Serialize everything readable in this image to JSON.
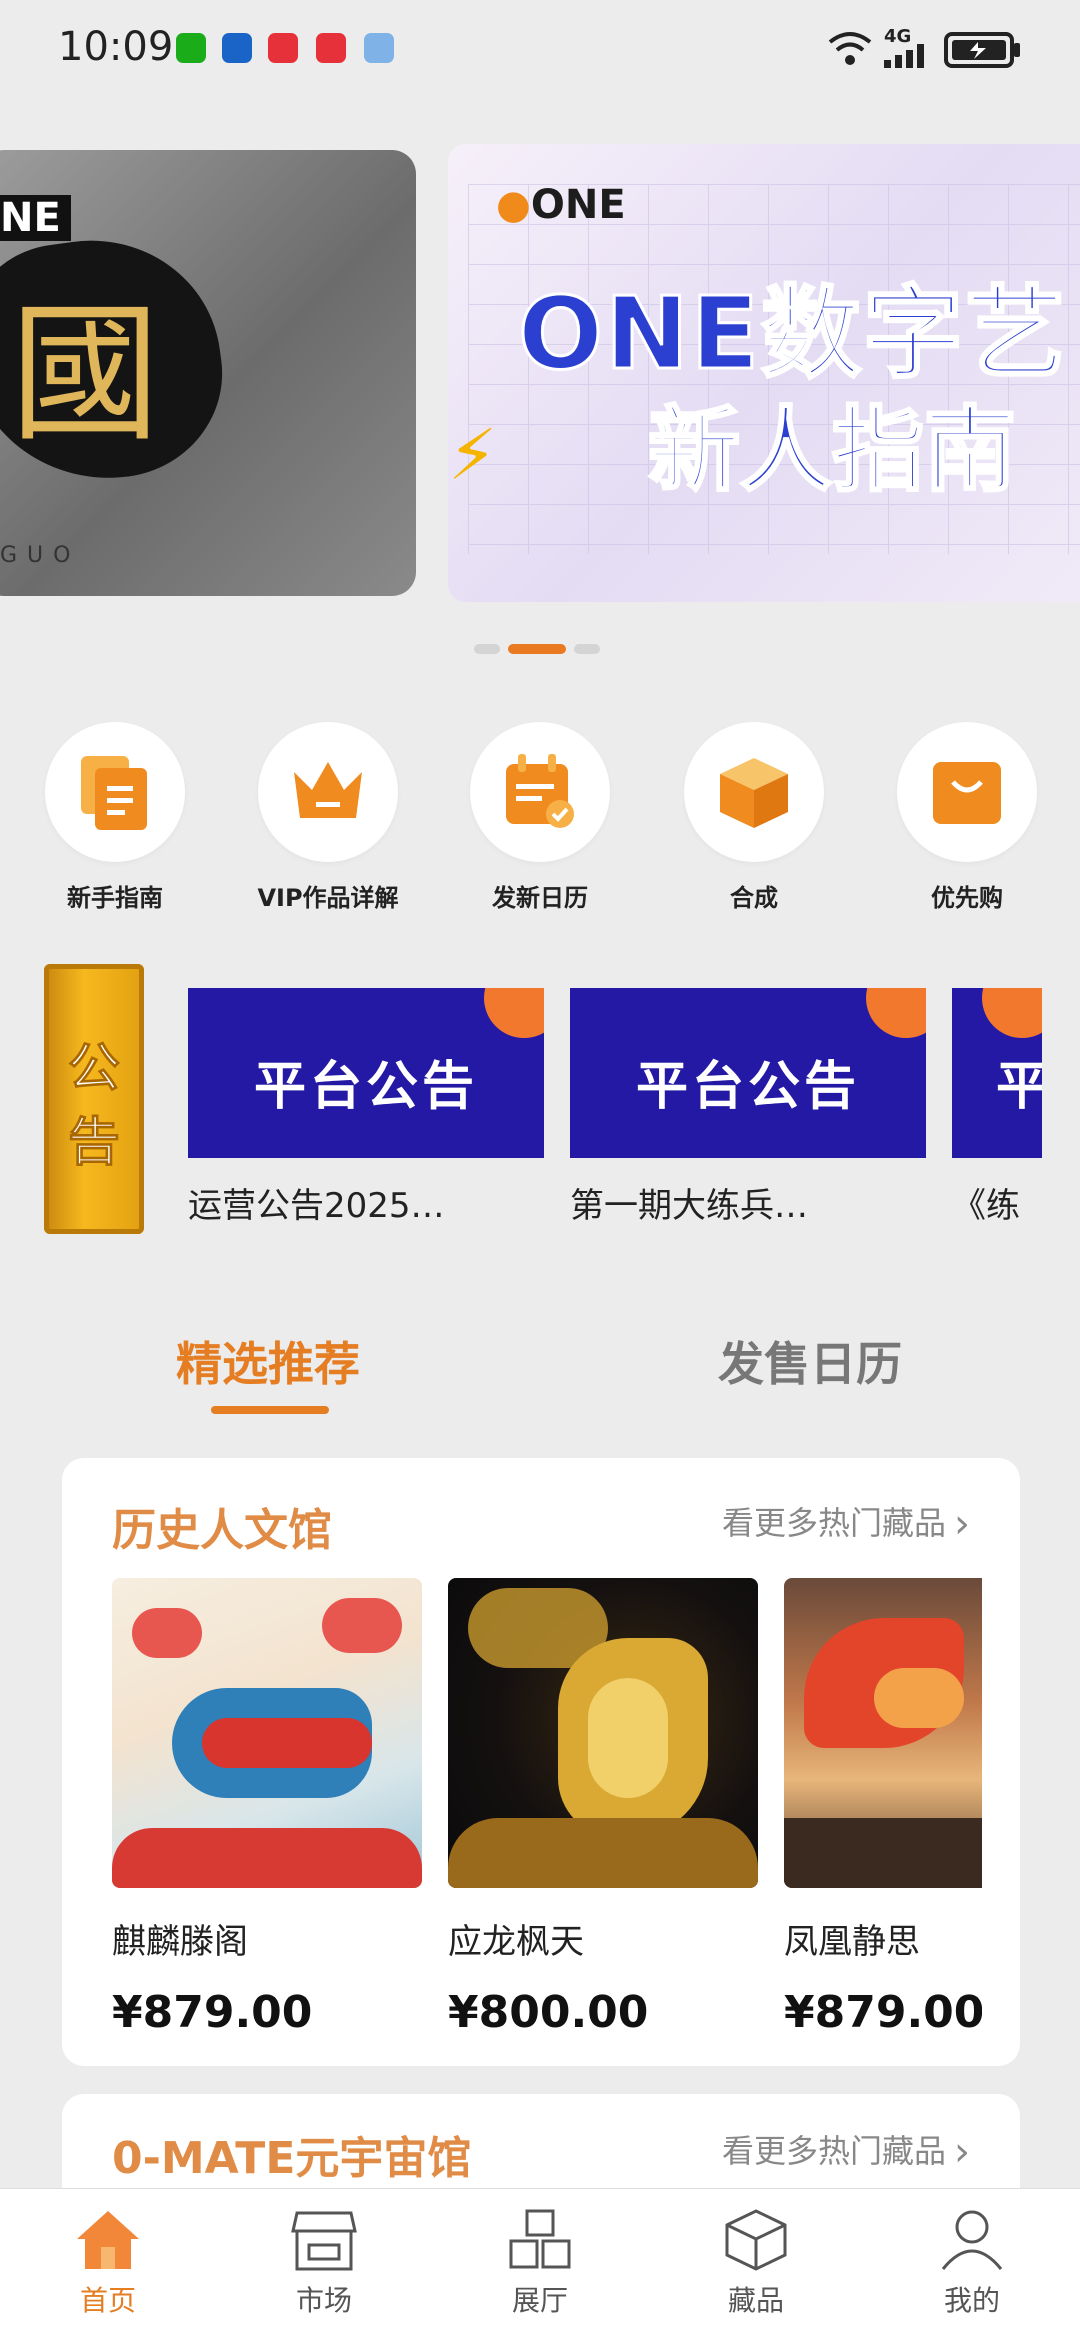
{
  "status_bar": {
    "time": "10:09",
    "network": "4G",
    "notification_icons": [
      "wechat-icon",
      "app-icon",
      "xiaohongshu-icon",
      "xiaohongshu-icon",
      "browser-icon"
    ]
  },
  "banner": {
    "left_slide": {
      "corner_text": "NE",
      "caption": "GUO"
    },
    "right_slide": {
      "logo": "ONE",
      "title_line1": "ONE数字艺",
      "title_line2": "新人指南"
    },
    "page_count": 3,
    "active_index": 1
  },
  "quick_menu": [
    {
      "label": "新手指南",
      "icon": "guide-icon"
    },
    {
      "label": "VIP作品详解",
      "icon": "crown-icon"
    },
    {
      "label": "发新日历",
      "icon": "calendar-icon"
    },
    {
      "label": "合成",
      "icon": "cube-icon"
    },
    {
      "label": "优先购",
      "icon": "shopping-bag-icon"
    }
  ],
  "announcement": {
    "tag": [
      "公",
      "告"
    ],
    "items": [
      {
        "image_text": "平台公告",
        "title": "运营公告2025…"
      },
      {
        "image_text": "平台公告",
        "title": "第一期大练兵…"
      },
      {
        "image_text": "平",
        "title": "《练"
      }
    ]
  },
  "tabs": [
    {
      "label": "精选推荐",
      "active": true
    },
    {
      "label": "发售日历",
      "active": false
    }
  ],
  "sections": [
    {
      "title": "历史人文馆",
      "more_label": "看更多热门藏品",
      "items": [
        {
          "name": "麒麟滕阁",
          "price": "¥879.00"
        },
        {
          "name": "应龙枫天",
          "price": "¥800.00"
        },
        {
          "name": "凤凰静思",
          "price": "¥879.00"
        }
      ]
    },
    {
      "title": "0-MATE元宇宙馆",
      "more_label": "看更多热门藏品"
    }
  ],
  "bottom_nav": [
    {
      "label": "首页",
      "icon": "home-icon",
      "active": true
    },
    {
      "label": "市场",
      "icon": "store-icon",
      "active": false
    },
    {
      "label": "展厅",
      "icon": "gallery-icon",
      "active": false
    },
    {
      "label": "藏品",
      "icon": "box-icon",
      "active": false
    },
    {
      "label": "我的",
      "icon": "profile-icon",
      "active": false
    }
  ],
  "colors": {
    "accent": "#e57d23",
    "background": "#ececec",
    "section_title": "#e08b46",
    "notice_blue": "#2419a5"
  }
}
